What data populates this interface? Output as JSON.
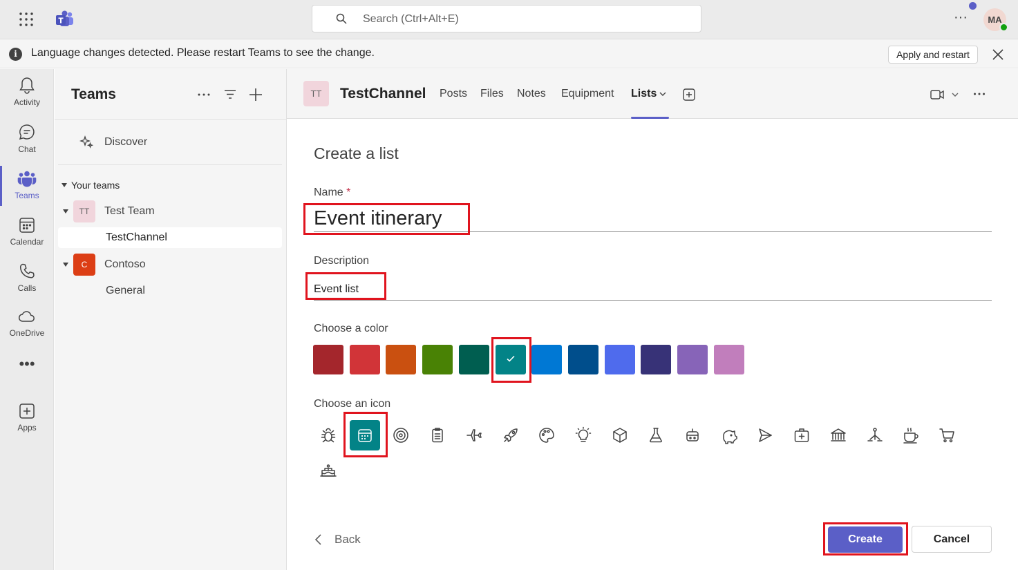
{
  "topbar": {
    "search_placeholder": "Search (Ctrl+Alt+E)",
    "avatar_initials": "MA",
    "icons": [
      "app-launcher-icon",
      "teams-logo-icon",
      "search-icon",
      "more-icon"
    ]
  },
  "banner": {
    "message": "Language changes detected. Please restart Teams to see the change.",
    "apply_label": "Apply and restart"
  },
  "rail": {
    "items": [
      {
        "label": "Activity",
        "icon": "bell-icon"
      },
      {
        "label": "Chat",
        "icon": "chat-icon"
      },
      {
        "label": "Teams",
        "icon": "teams-icon",
        "active": true
      },
      {
        "label": "Calendar",
        "icon": "calendar-icon"
      },
      {
        "label": "Calls",
        "icon": "phone-icon"
      },
      {
        "label": "OneDrive",
        "icon": "cloud-icon"
      },
      {
        "label": "Apps",
        "icon": "add-app-icon"
      }
    ],
    "more_label": "•••"
  },
  "pane": {
    "title": "Teams",
    "discover_label": "Discover",
    "section_label": "Your teams",
    "teams": [
      {
        "initials": "TT",
        "name": "Test Team",
        "avatar_bg": "#f1d5dc",
        "avatar_fg": "#616161",
        "channels": [
          "TestChannel"
        ]
      },
      {
        "initials": "C",
        "name": "Contoso",
        "avatar_bg": "#dc3e15",
        "avatar_fg": "#ffffff",
        "channels": [
          "General"
        ]
      }
    ]
  },
  "channel": {
    "initials": "TT",
    "title": "TestChannel",
    "tabs": [
      "Posts",
      "Files",
      "Notes",
      "Equipment",
      "Lists"
    ],
    "active_tab": "Lists"
  },
  "form": {
    "title": "Create a list",
    "name_label": "Name",
    "required_mark": "*",
    "name_value": "Event itinerary",
    "description_label": "Description",
    "description_value": "Event list",
    "color_label": "Choose a color",
    "colors": [
      "#a4262c",
      "#d13438",
      "#ca5010",
      "#498205",
      "#005e50",
      "#038387",
      "#0078d4",
      "#004e8c",
      "#4f6bed",
      "#373277",
      "#8764b8",
      "#c17ebc"
    ],
    "selected_color": "#038387",
    "icon_label": "Choose an icon",
    "icons": [
      "bug-icon",
      "calendar-icon",
      "target-icon",
      "clipboard-icon",
      "airplane-icon",
      "rocket-icon",
      "palette-icon",
      "lightbulb-icon",
      "cube-icon",
      "beaker-icon",
      "robot-icon",
      "piggy-bank-icon",
      "send-icon",
      "medical-kit-icon",
      "bank-icon",
      "hierarchy-icon",
      "coffee-icon",
      "shopping-cart-icon",
      "cake-icon"
    ],
    "selected_icon": "calendar-icon",
    "back_label": "Back",
    "create_label": "Create",
    "cancel_label": "Cancel"
  }
}
